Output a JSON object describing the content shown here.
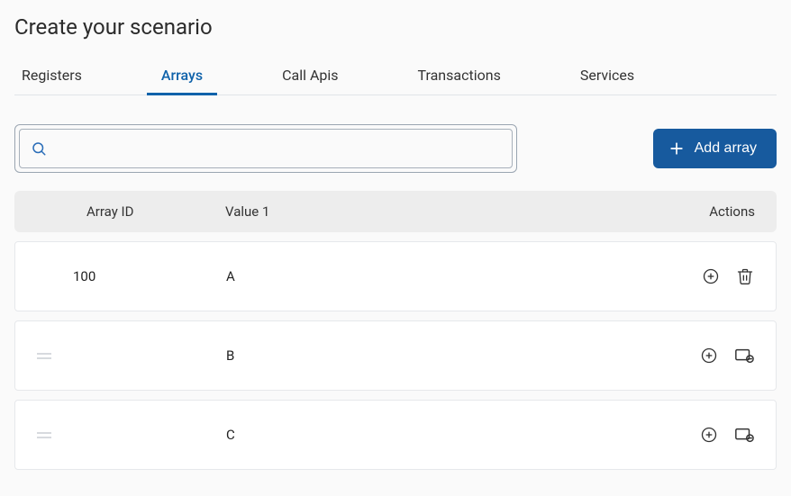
{
  "title": "Create your scenario",
  "tabs": [
    {
      "label": "Registers",
      "active": false
    },
    {
      "label": "Arrays",
      "active": true
    },
    {
      "label": "Call Apis",
      "active": false
    },
    {
      "label": "Transactions",
      "active": false
    },
    {
      "label": "Services",
      "active": false
    }
  ],
  "search": {
    "value": "",
    "placeholder": ""
  },
  "add_button": {
    "label": "Add array"
  },
  "columns": {
    "id": "Array ID",
    "value": "Value 1",
    "actions": "Actions"
  },
  "rows": [
    {
      "draggable": false,
      "id": "100",
      "value": "A",
      "actions": [
        "add",
        "delete"
      ]
    },
    {
      "draggable": true,
      "id": "",
      "value": "B",
      "actions": [
        "add",
        "unlink"
      ]
    },
    {
      "draggable": true,
      "id": "",
      "value": "C",
      "actions": [
        "add",
        "unlink"
      ]
    }
  ]
}
